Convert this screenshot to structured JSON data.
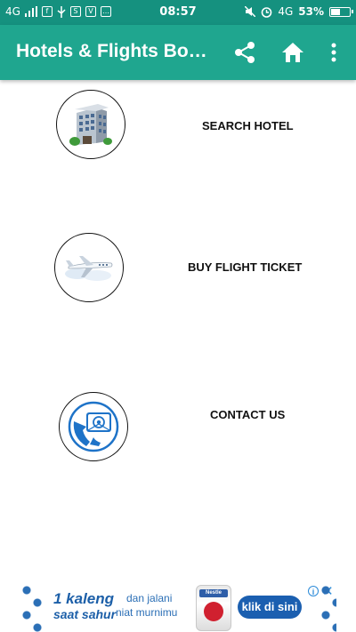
{
  "status_bar": {
    "network_left": "4G",
    "time": "08:57",
    "network_right": "4G",
    "battery_percent": "53%",
    "battery_level": 0.53,
    "icons_left": [
      "signal-icon",
      "facebook-icon",
      "usb-icon",
      "notification-icon",
      "app-icon",
      "chat-icon"
    ],
    "icons_right": [
      "mute-icon",
      "alarm-icon"
    ]
  },
  "app_bar": {
    "title": "Hotels & Flights Booking",
    "actions": [
      "share-icon",
      "home-icon",
      "overflow-menu-icon"
    ],
    "color": "#1fa68f"
  },
  "menu": {
    "items": [
      {
        "label": "SEARCH HOTEL",
        "icon": "hotel-building-icon"
      },
      {
        "label": "BUY FLIGHT TICKET",
        "icon": "airplane-icon"
      },
      {
        "label": "CONTACT US",
        "icon": "contact-phone-mail-icon"
      }
    ]
  },
  "ad": {
    "headline_1": "1 kaleng",
    "headline_2": "saat sahur",
    "tagline_1": "dan jalani",
    "tagline_2": "niat murnimu",
    "brand": "Nestle",
    "cta": "klik di sini",
    "info_icon": "i",
    "close_icon": "✕"
  }
}
